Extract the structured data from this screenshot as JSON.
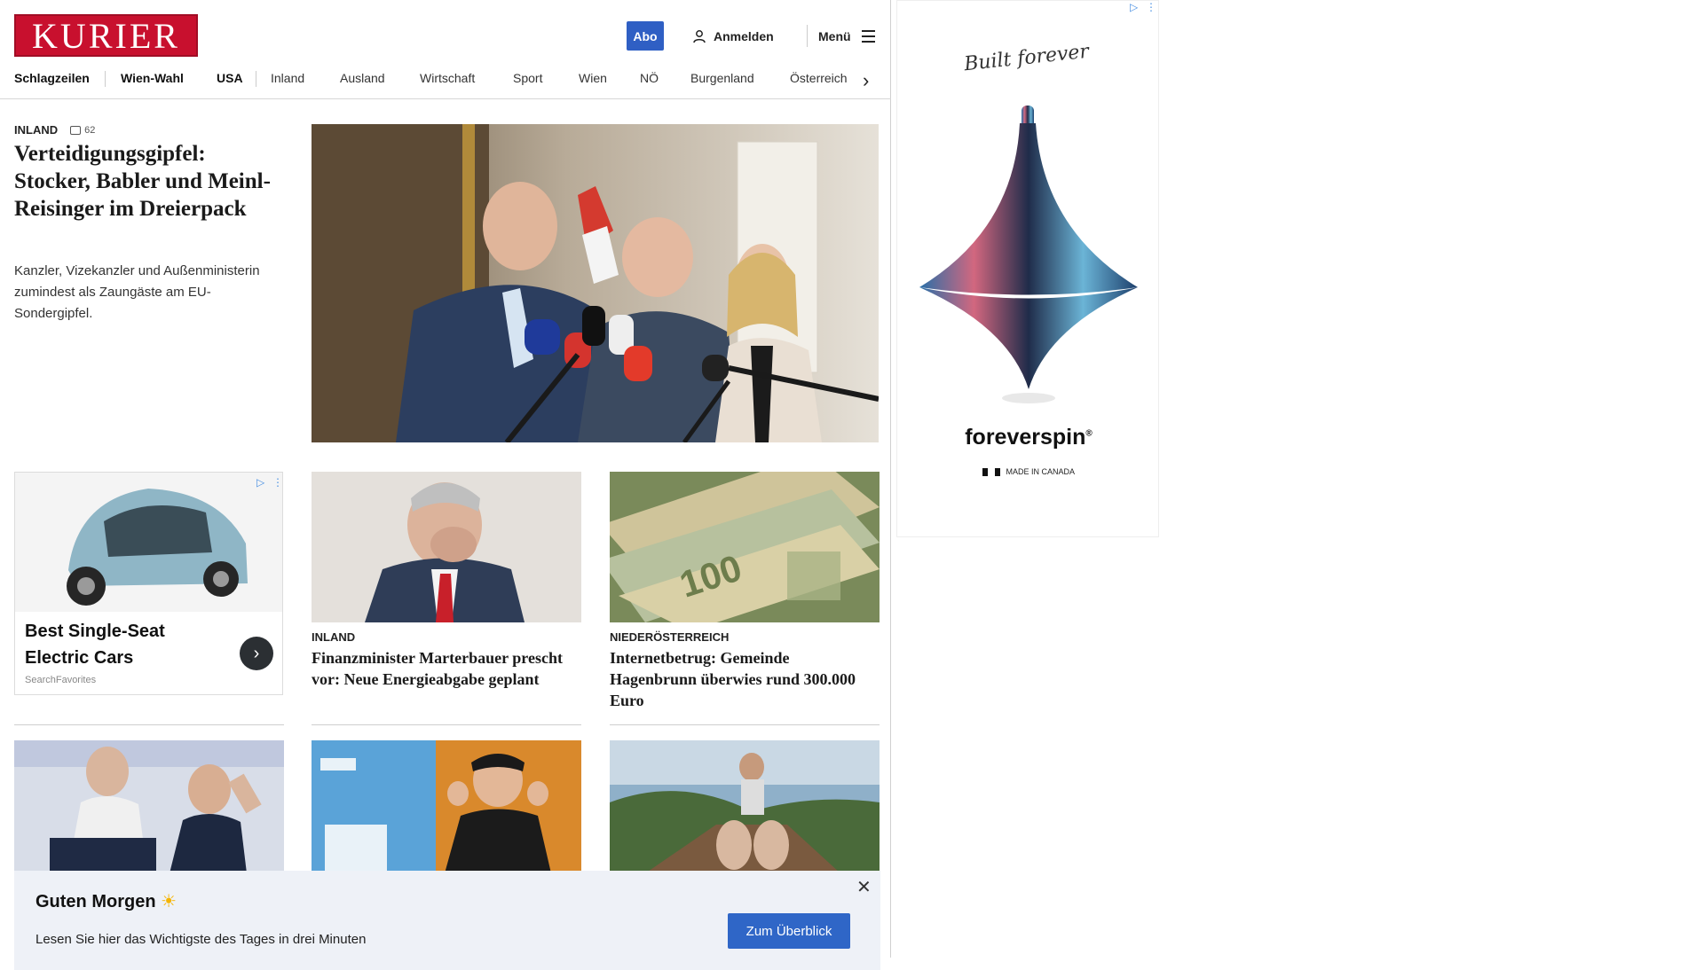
{
  "header": {
    "logo_text": "KURIER",
    "abo_label": "Abo",
    "login_label": "Anmelden",
    "menu_label": "Menü"
  },
  "nav": {
    "items": [
      "Schlagzeilen",
      "Wien-Wahl",
      "USA",
      "Inland",
      "Ausland",
      "Wirtschaft",
      "Sport",
      "Wien",
      "NÖ",
      "Burgenland",
      "Österreich"
    ]
  },
  "lead": {
    "kicker": "INLAND",
    "comments": "62",
    "title": "Verteidigungsgipfel: Stocker, Babler und Meinl-Reisinger im Dreierpack",
    "teaser": "Kanzler, Vizekanzler und Außenministerin zumindest als Zaungäste am EU-Sondergipfel."
  },
  "ad_card": {
    "title": "Best Single-Seat Electric Cars",
    "source": "SearchFavorites"
  },
  "cards": [
    {
      "kicker": "INLAND",
      "title": "Finanzminister Marterbauer prescht vor: Neue Energieabgabe geplant"
    },
    {
      "kicker": "NIEDERÖSTERREICH",
      "title": "Internetbetrug: Gemeinde Hagenbrunn überwies rund 300.000 Euro"
    }
  ],
  "side_ad": {
    "script_text": "Built forever",
    "brand": "foreverspin",
    "made_in": "MADE IN CANADA"
  },
  "banner": {
    "title": "Guten Morgen",
    "text": "Lesen Sie hier das Wichtigste des Tages in drei Minuten",
    "button": "Zum Überblick"
  },
  "colors": {
    "brand_red": "#c8102e",
    "accent_blue": "#2f5fc4",
    "banner_bg": "#eef1f7"
  },
  "icons": [
    "user-icon",
    "menu-icon",
    "chevron-right-icon",
    "comment-icon",
    "close-icon",
    "sun-icon",
    "ad-choices-icon"
  ]
}
